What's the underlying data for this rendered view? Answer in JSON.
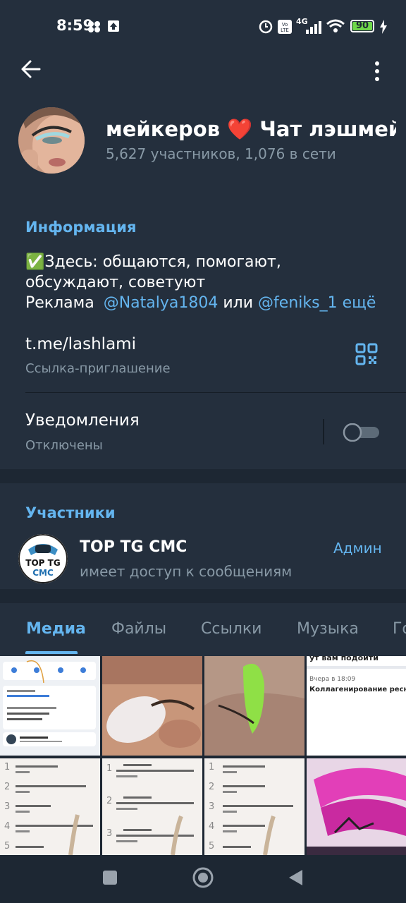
{
  "status_bar": {
    "time": "8:59",
    "battery": "90",
    "network": "4G"
  },
  "header": {
    "title": "мейкеров ❤️   Чат лэшмейке",
    "subtitle": "5,627 участников, 1,076 в сети"
  },
  "info": {
    "heading": "Информация",
    "desc_line1": "✅Здесь: общаются, помогают,",
    "desc_line2": "обсуждают, советуют",
    "desc_ad": "Реклама",
    "mention1": "@Natalya1804",
    "mention_or": "или",
    "mention2": "@feniks_1",
    "more": "ещё",
    "link_value": "t.me/lashlami",
    "link_label": "Ссылка-приглашение",
    "notif_title": "Уведомления",
    "notif_state": "Отключены"
  },
  "members": {
    "heading": "Участники",
    "items": [
      {
        "name": "TOP TG CMC",
        "status": "имеет доступ к сообщениям",
        "role": "Админ",
        "avatar_text_top": "TOP TG",
        "avatar_text_bottom": "CMC"
      }
    ]
  },
  "tabs": [
    "Медиа",
    "Файлы",
    "Ссылки",
    "Музыка",
    "Го"
  ],
  "media": {
    "cell4_top": "ут вам подойти",
    "cell4_time": "Вчера в 18:09",
    "cell4_title": "Коллагенирование ресниц"
  },
  "colors": {
    "accent": "#64b5ef",
    "bg": "#1d2733",
    "panel": "#242f3d",
    "battery": "#6fd84a"
  }
}
